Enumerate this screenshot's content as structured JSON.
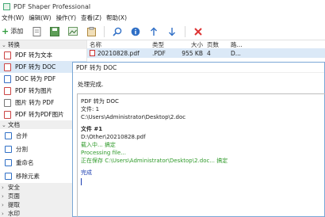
{
  "window": {
    "title": "PDF Shaper Professional"
  },
  "menu": [
    "文件(W)",
    "编辑(W)",
    "操作(Y)",
    "查看(Z)",
    "帮助(X)"
  ],
  "toolbar": {
    "add_label": "添加"
  },
  "sidebar": {
    "group_convert": "转换",
    "convert_items": [
      {
        "label": "PDF 转为文本"
      },
      {
        "label": "PDF 转为 DOC"
      },
      {
        "label": "DOC 转为 PDF"
      },
      {
        "label": "PDF 转为图片"
      },
      {
        "label": "图片 转为 PDF"
      },
      {
        "label": "PDF 转为PDF图片"
      }
    ],
    "group_document": "文档",
    "document_items": [
      {
        "label": "合并"
      },
      {
        "label": "分割"
      },
      {
        "label": "重命名"
      },
      {
        "label": "移除元素"
      }
    ],
    "collapsed_groups": [
      "安全",
      "页面",
      "提取",
      "水印"
    ]
  },
  "filelist": {
    "headers": {
      "name": "名称",
      "type": "类型",
      "size": "大小",
      "pages": "页数",
      "path": "路..."
    },
    "rows": [
      {
        "name": "20210828.pdf",
        "type": ".PDF",
        "size": "955 KB",
        "pages": "4",
        "path": "D..."
      }
    ]
  },
  "dialog": {
    "title": "PDF 转为 DOC",
    "status": "处理完成.",
    "log": {
      "op": "PDF 转为 DOC",
      "files": "文件: 1",
      "out_dir": "C:\\Users\\Administrator\\Desktop\\2.doc",
      "file_header": "文件 #1",
      "src": "D:\\Other\\20210828.pdf",
      "loading": "载入中... 搞定",
      "processing": "Processing file...",
      "saving": "正在保存 C:\\Users\\Administrator\\Desktop\\2.doc... 搞定",
      "done": "完成"
    }
  },
  "colors": {
    "selection": "#dbe9f7",
    "ok_green": "#2f9a2a",
    "done_blue": "#1d3fb2",
    "dialog_border": "#7aa7d6"
  }
}
